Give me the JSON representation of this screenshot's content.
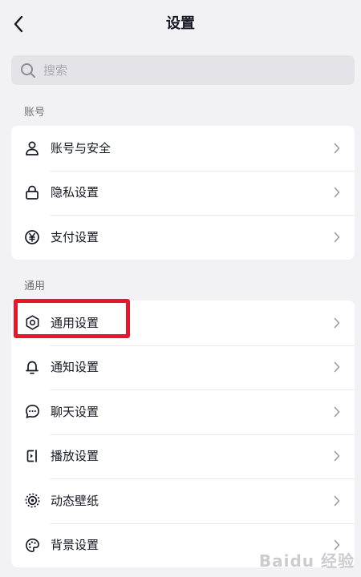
{
  "header": {
    "title": "设置",
    "back_icon": "chevron-left-icon"
  },
  "search": {
    "placeholder": "搜索",
    "value": "",
    "icon": "search-icon"
  },
  "sections": [
    {
      "label": "账号",
      "items": [
        {
          "label": "账号与安全",
          "icon": "user-icon"
        },
        {
          "label": "隐私设置",
          "icon": "lock-icon"
        },
        {
          "label": "支付设置",
          "icon": "yuan-icon"
        }
      ]
    },
    {
      "label": "通用",
      "items": [
        {
          "label": "通用设置",
          "icon": "gear-icon",
          "highlighted": true
        },
        {
          "label": "通知设置",
          "icon": "bell-icon"
        },
        {
          "label": "聊天设置",
          "icon": "chat-bubble-icon"
        },
        {
          "label": "播放设置",
          "icon": "play-settings-icon"
        },
        {
          "label": "动态壁纸",
          "icon": "live-wallpaper-icon"
        },
        {
          "label": "背景设置",
          "icon": "palette-icon"
        }
      ]
    }
  ],
  "annotation": {
    "highlight_color": "#e8152b"
  },
  "watermark": {
    "text": "Baidu 经验"
  }
}
